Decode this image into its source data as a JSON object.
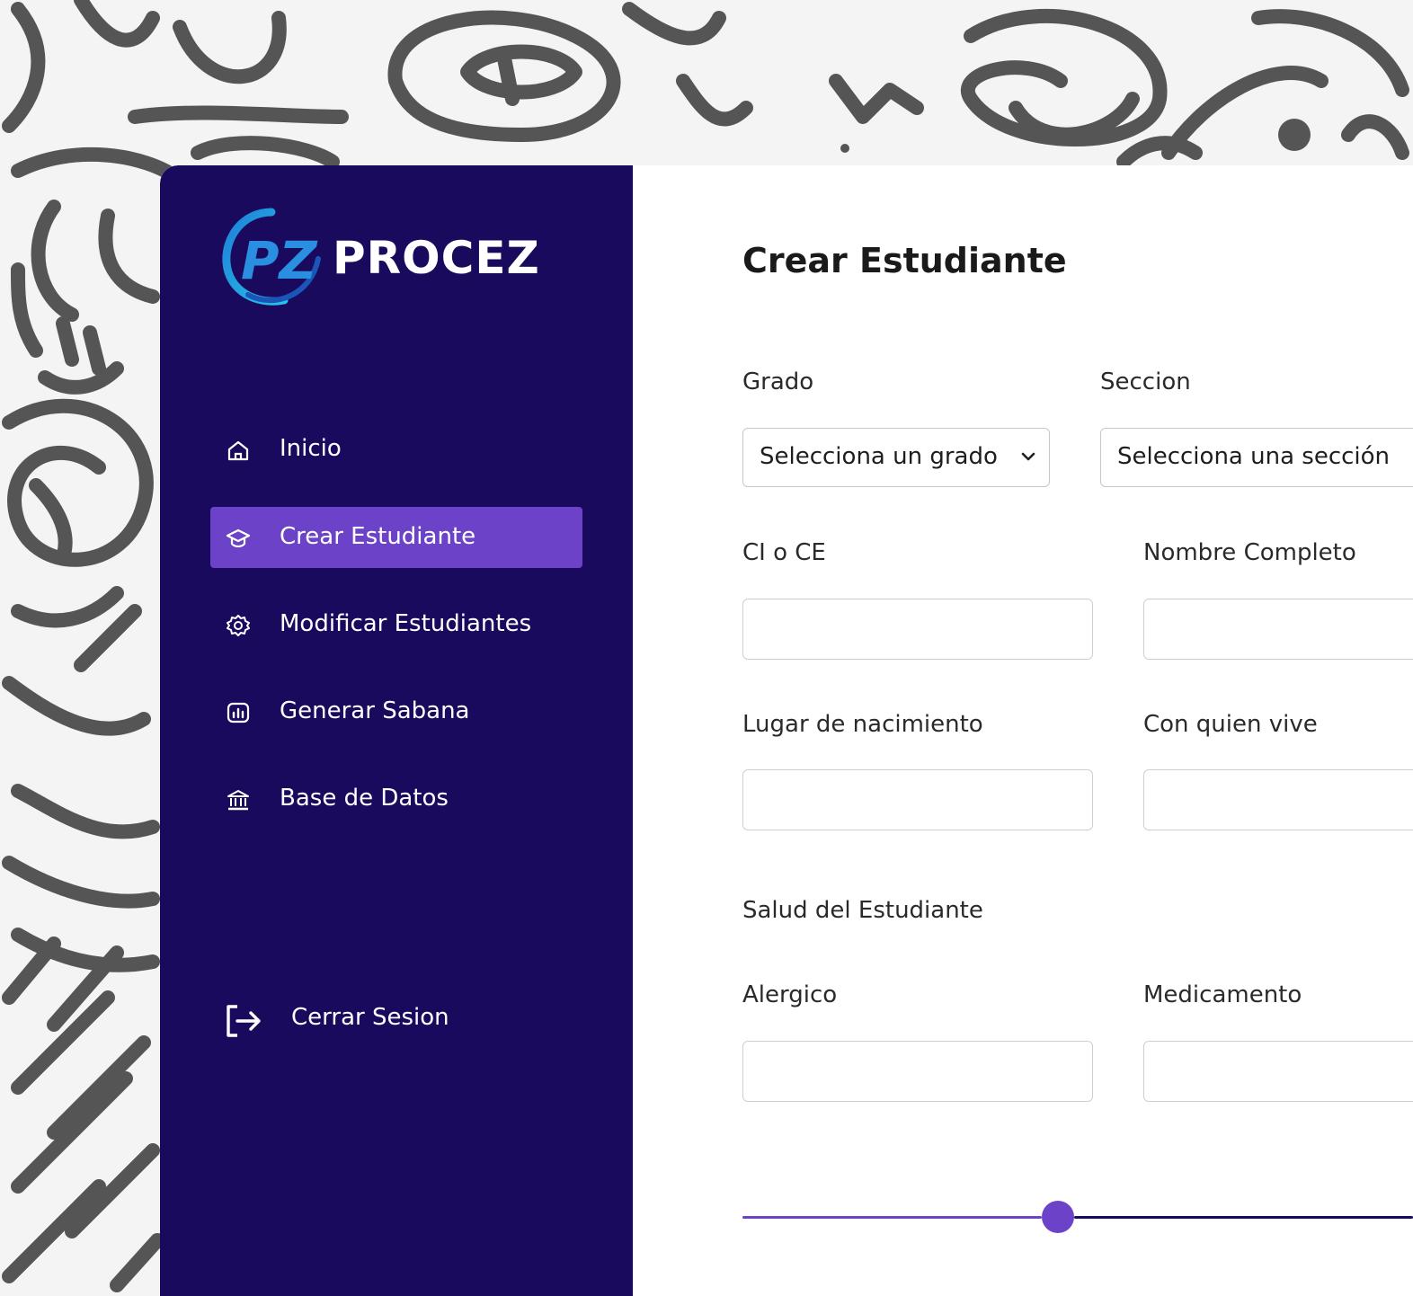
{
  "app": {
    "logo_text": "PROCEZ",
    "logo_mark": "PZ"
  },
  "colors": {
    "sidebar": "#1a0a5e",
    "accent": "#6b42c8",
    "background_doodle": "#555555"
  },
  "sidebar": {
    "items": [
      {
        "label": "Inicio",
        "icon": "home-icon",
        "active": false
      },
      {
        "label": "Crear Estudiante",
        "icon": "graduation-cap-icon",
        "active": true
      },
      {
        "label": "Modificar Estudiantes",
        "icon": "gear-icon",
        "active": false
      },
      {
        "label": "Generar Sabana",
        "icon": "chart-icon",
        "active": false
      },
      {
        "label": "Base de Datos",
        "icon": "bank-icon",
        "active": false
      }
    ],
    "logout_label": "Cerrar Sesion"
  },
  "form": {
    "title": "Crear Estudiante",
    "grado": {
      "label": "Grado",
      "value": "Selecciona un grado"
    },
    "seccion": {
      "label": "Seccion",
      "value": "Selecciona una sección"
    },
    "ci": {
      "label": "CI o CE",
      "value": ""
    },
    "nombre": {
      "label": "Nombre Completo",
      "value": ""
    },
    "lugar": {
      "label": "Lugar de nacimiento",
      "value": ""
    },
    "vive": {
      "label": "Con quien vive",
      "value": ""
    },
    "salud_title": "Salud del Estudiante",
    "alergico": {
      "label": "Alergico",
      "value": ""
    },
    "medicamento": {
      "label": "Medicamento",
      "value": ""
    },
    "progress": 0.47
  }
}
